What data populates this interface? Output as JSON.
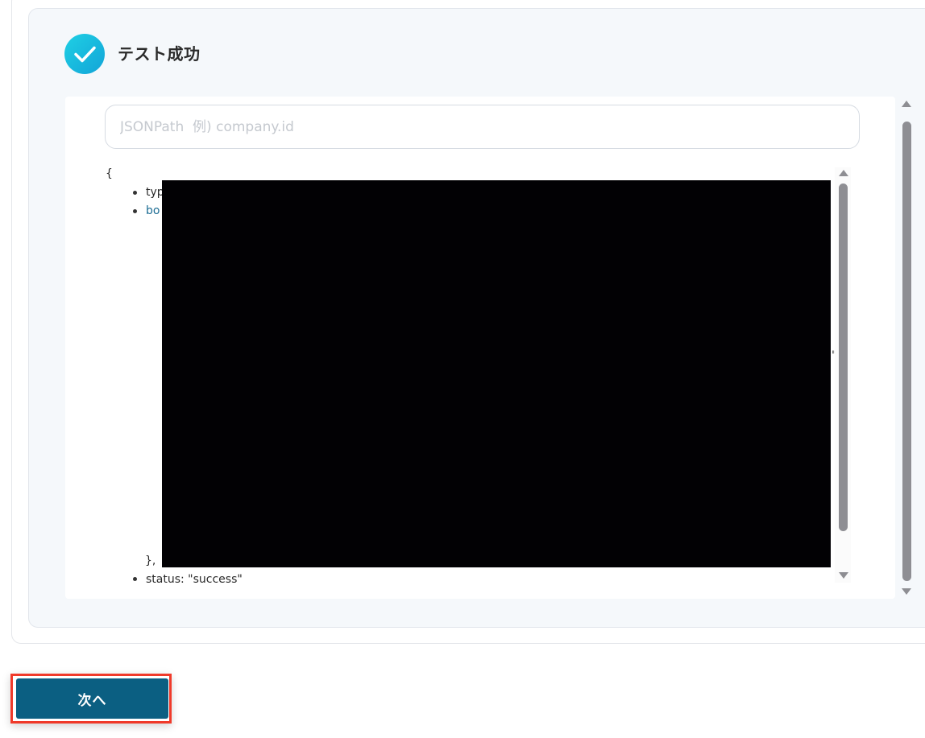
{
  "test_result": {
    "title": "テスト成功",
    "icon": "check-circle-icon",
    "accent_color": "#16b9e0"
  },
  "jsonpath_search": {
    "placeholder": "JSONPath  例) company.id",
    "value": ""
  },
  "json_output": {
    "open_brace": "{",
    "items": [
      {
        "text": "typ"
      },
      {
        "text": "bo"
      }
    ],
    "closing": "},",
    "status_line": "status: \"success\"",
    "stray_char": "\""
  },
  "footer": {
    "next_label": "次へ",
    "button_color": "#0b5f82",
    "highlight_color": "#f03a2a"
  }
}
